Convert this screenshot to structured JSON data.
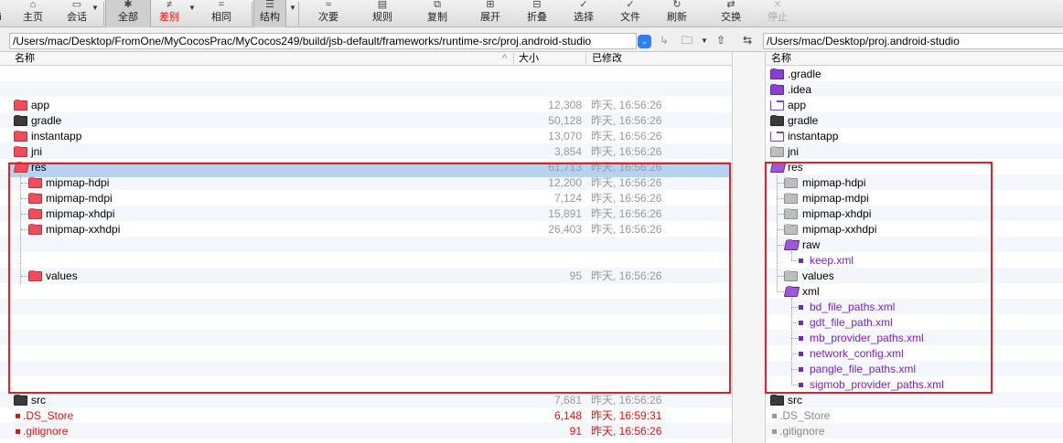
{
  "toolbar": {
    "items": [
      {
        "label": "主页",
        "icon": "home-icon",
        "glyph": "⌂"
      },
      {
        "label": "会话",
        "icon": "session-icon",
        "glyph": "▭"
      },
      {
        "label": "全部",
        "icon": "all-icon",
        "glyph": "✱"
      },
      {
        "label": "差别",
        "icon": "diff-icon",
        "glyph": "≠"
      },
      {
        "label": "相同",
        "icon": "same-icon",
        "glyph": "="
      },
      {
        "label": "结构",
        "icon": "structure-icon",
        "glyph": "☰"
      },
      {
        "label": "次要",
        "icon": "minor-icon",
        "glyph": "≈"
      },
      {
        "label": "规则",
        "icon": "rules-icon",
        "glyph": "▤"
      },
      {
        "label": "复制",
        "icon": "copy-icon",
        "glyph": "⧉"
      },
      {
        "label": "展开",
        "icon": "expand-icon",
        "glyph": "⊞"
      },
      {
        "label": "折叠",
        "icon": "collapse-icon",
        "glyph": "⊟"
      },
      {
        "label": "选择",
        "icon": "select-icon",
        "glyph": "✓"
      },
      {
        "label": "文件",
        "icon": "file-icon",
        "glyph": "✓"
      },
      {
        "label": "刷新",
        "icon": "refresh-icon",
        "glyph": "↻"
      },
      {
        "label": "交换",
        "icon": "swap-icon",
        "glyph": "⇄"
      },
      {
        "label": "停止",
        "icon": "stop-icon",
        "glyph": "✕"
      }
    ],
    "edge_text": "oi"
  },
  "left": {
    "path": "/Users/mac/Desktop/FromOne/MyCocosPrac/MyCocos249/build/jsb-default/frameworks/runtime-src/proj.android-studio",
    "col_name": "名称",
    "col_size": "大小",
    "col_modified": "已修改",
    "sort_arrow": "^",
    "rows": [
      {
        "name": "app",
        "size": "12,308",
        "date": "昨天, 16:56:26"
      },
      {
        "name": "gradle",
        "size": "50,128",
        "date": "昨天, 16:56:26"
      },
      {
        "name": "instantapp",
        "size": "13,070",
        "date": "昨天, 16:56:26"
      },
      {
        "name": "jni",
        "size": "3,854",
        "date": "昨天, 16:56:26"
      },
      {
        "name": "res",
        "size": "61,713",
        "date": "昨天, 16:56:26"
      },
      {
        "name": "mipmap-hdpi",
        "size": "12,200",
        "date": "昨天, 16:56:26"
      },
      {
        "name": "mipmap-mdpi",
        "size": "7,124",
        "date": "昨天, 16:56:26"
      },
      {
        "name": "mipmap-xhdpi",
        "size": "15,891",
        "date": "昨天, 16:56:26"
      },
      {
        "name": "mipmap-xxhdpi",
        "size": "26,403",
        "date": "昨天, 16:56:26"
      },
      {
        "name": "values",
        "size": "95",
        "date": "昨天, 16:56:26"
      },
      {
        "name": "src",
        "size": "7,681",
        "date": "昨天, 16:56:26"
      },
      {
        "name": ".DS_Store",
        "size": "6,148",
        "date": "昨天, 16:59:31"
      },
      {
        "name": ".gitignore",
        "size": "91",
        "date": "昨天, 16:56:26"
      }
    ]
  },
  "right": {
    "path": "/Users/mac/Desktop/proj.android-studio",
    "col_name": "名称",
    "rows": [
      {
        "name": ".gradle"
      },
      {
        "name": ".idea"
      },
      {
        "name": "app"
      },
      {
        "name": "gradle"
      },
      {
        "name": "instantapp"
      },
      {
        "name": "jni"
      },
      {
        "name": "res"
      },
      {
        "name": "mipmap-hdpi"
      },
      {
        "name": "mipmap-mdpi"
      },
      {
        "name": "mipmap-xhdpi"
      },
      {
        "name": "mipmap-xxhdpi"
      },
      {
        "name": "raw"
      },
      {
        "name": "keep.xml"
      },
      {
        "name": "values"
      },
      {
        "name": "xml"
      },
      {
        "name": "bd_file_paths.xml"
      },
      {
        "name": "gdt_file_path.xml"
      },
      {
        "name": "mb_provider_paths.xml"
      },
      {
        "name": "network_config.xml"
      },
      {
        "name": "pangle_file_paths.xml"
      },
      {
        "name": "sigmob_provider_paths.xml"
      },
      {
        "name": "src"
      },
      {
        "name": ".DS_Store"
      },
      {
        "name": ".gitignore"
      }
    ]
  },
  "colors": {
    "orphan": "#e81010",
    "purple": "#7722cc",
    "selection": "#b6d2ee",
    "highlight": "#e0202a",
    "toggle": "#2f7ff0"
  }
}
